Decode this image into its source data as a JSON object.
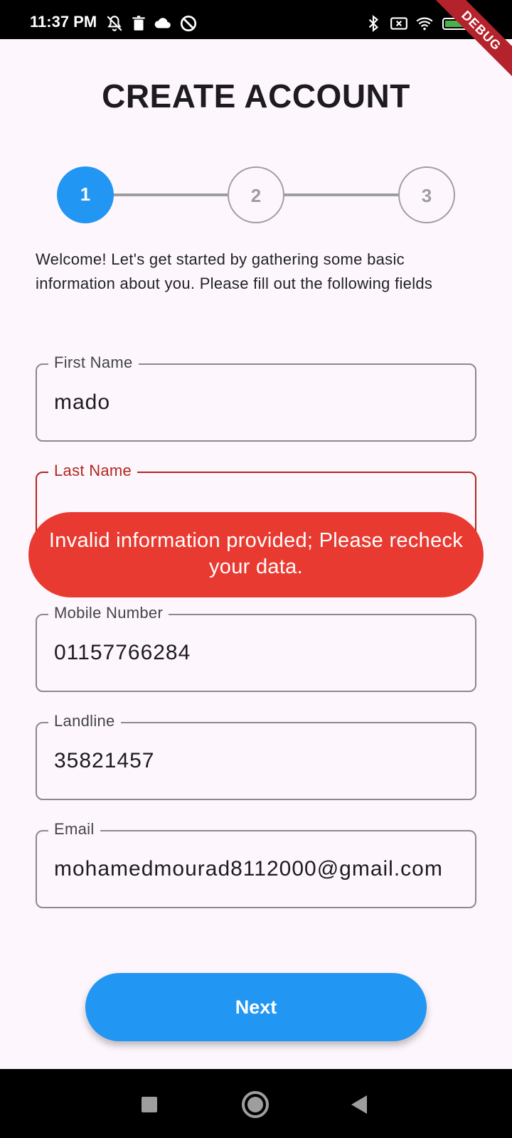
{
  "status_bar": {
    "time": "11:37 PM",
    "debug_label": "DEBUG"
  },
  "header": {
    "title": "CREATE ACCOUNT"
  },
  "stepper": {
    "steps": [
      "1",
      "2",
      "3"
    ],
    "current_step": 1,
    "active_color": "#2196f3",
    "inactive_color": "#9e9e9e"
  },
  "intro_text": "Welcome! Let's get started by gathering some basic information about you. Please fill out the following fields",
  "form": {
    "first_name": {
      "label": "First Name",
      "value": "mado"
    },
    "last_name": {
      "label": "Last Name",
      "value": ""
    },
    "mobile": {
      "label": "Mobile Number",
      "value": "01157766284"
    },
    "landline": {
      "label": "Landline",
      "value": "35821457"
    },
    "email": {
      "label": "Email",
      "value": "mohamedmourad8112000@gmail.com"
    }
  },
  "toast": {
    "message": "Invalid information provided; Please recheck your data.",
    "color": "#e93a31"
  },
  "actions": {
    "next_label": "Next",
    "button_color": "#2196f3"
  },
  "colors": {
    "error": "#b3261e",
    "background": "#fdf7fd"
  },
  "nav": {
    "icons": [
      "recents-square-icon",
      "home-circle-icon",
      "back-triangle-icon"
    ]
  }
}
